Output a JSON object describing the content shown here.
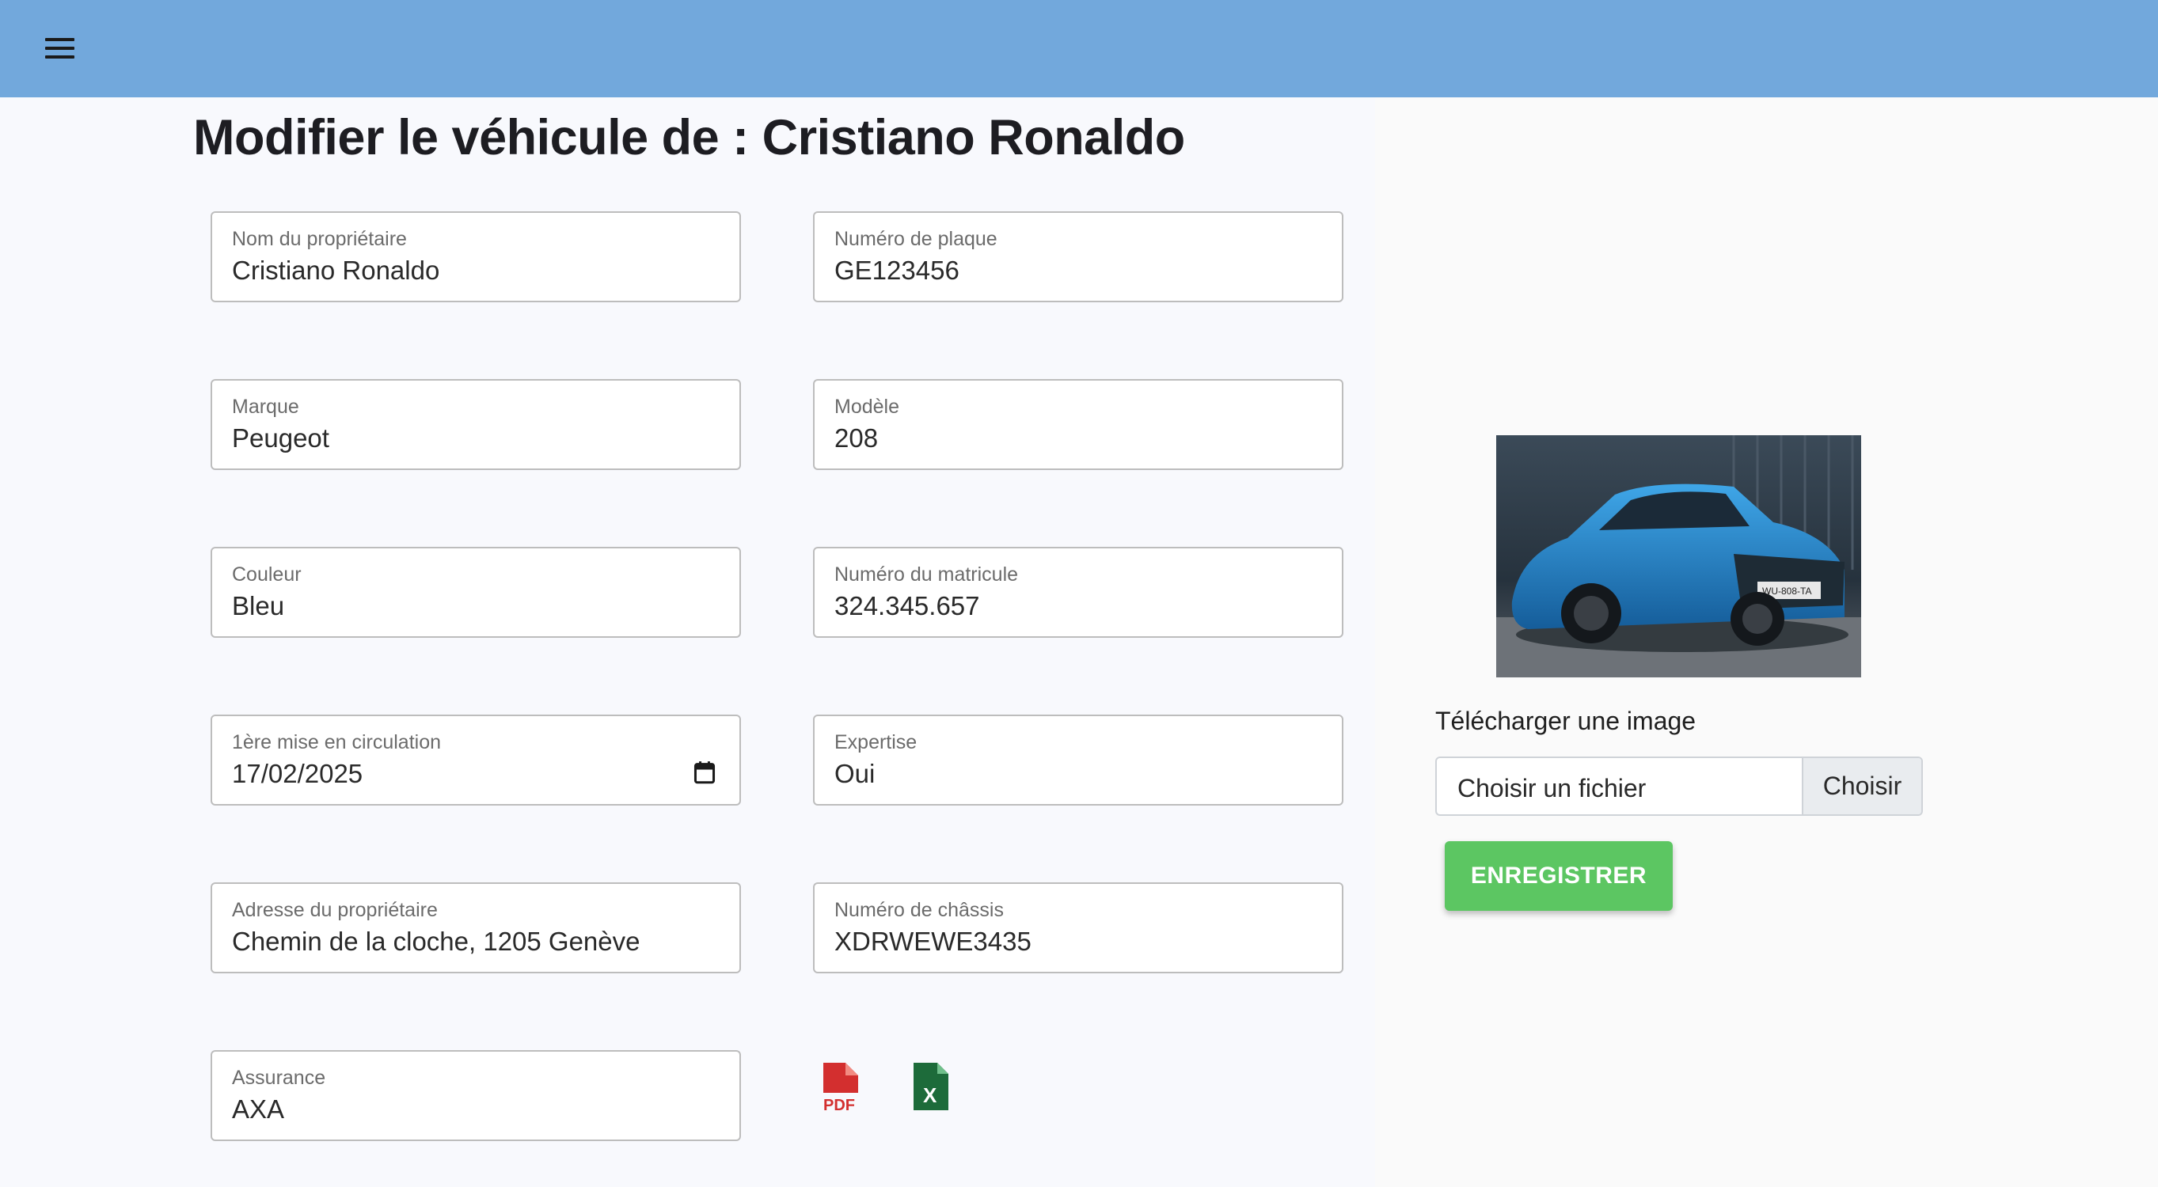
{
  "header": {
    "menu_icon": "menu-icon",
    "bar_color": "#72a8dc"
  },
  "page": {
    "title": "Modifier le véhicule de : Cristiano Ronaldo"
  },
  "form": {
    "owner_name": {
      "label": "Nom du propriétaire",
      "value": "Cristiano Ronaldo"
    },
    "plate_number": {
      "label": "Numéro de plaque",
      "value": "GE123456"
    },
    "brand": {
      "label": "Marque",
      "value": "Peugeot"
    },
    "model": {
      "label": "Modèle",
      "value": "208"
    },
    "color": {
      "label": "Couleur",
      "value": "Bleu"
    },
    "registration_number": {
      "label": "Numéro du matricule",
      "value": "324.345.657"
    },
    "first_registration": {
      "label": "1ère mise en circulation",
      "value": "17/02/2025",
      "icon": "calendar-icon"
    },
    "expertise": {
      "label": "Expertise",
      "value": "Oui"
    },
    "owner_address": {
      "label": "Adresse du propriétaire",
      "value": "Chemin de la cloche, 1205 Genève"
    },
    "chassis_number": {
      "label": "Numéro de châssis",
      "value": "XDRWEWE3435"
    },
    "insurance": {
      "label": "Assurance",
      "value": "AXA"
    }
  },
  "exports": {
    "pdf_icon": "pdf-file-icon",
    "pdf_text": "PDF",
    "pdf_color": "#d32f2f",
    "excel_icon": "excel-file-icon",
    "excel_text": "X",
    "excel_color": "#1d6b3a"
  },
  "upload": {
    "label": "Télécharger une image",
    "file_placeholder": "Choisir un fichier",
    "browse_label": "Choisir",
    "plate_on_image": "WU-808-TA"
  },
  "actions": {
    "save_label": "ENREGISTRER",
    "save_color": "#5cc662"
  }
}
